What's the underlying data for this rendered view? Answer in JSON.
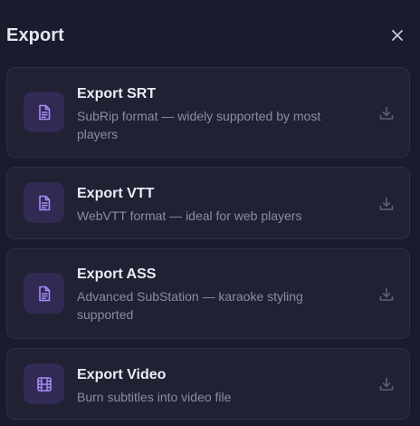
{
  "dialog": {
    "title": "Export",
    "close_icon": "close-icon"
  },
  "options": [
    {
      "title": "Export SRT",
      "description": "SubRip format — widely supported by most players",
      "icon": "document-icon",
      "action_icon": "download-icon"
    },
    {
      "title": "Export VTT",
      "description": "WebVTT format — ideal for web players",
      "icon": "document-icon",
      "action_icon": "download-icon"
    },
    {
      "title": "Export ASS",
      "description": "Advanced SubStation — karaoke styling supported",
      "icon": "document-icon",
      "action_icon": "download-icon"
    },
    {
      "title": "Export Video",
      "description": "Burn subtitles into video file",
      "icon": "film-icon",
      "action_icon": "download-icon"
    }
  ],
  "colors": {
    "background": "#1a1b2c",
    "card": "#202133",
    "card_border": "#2e3045",
    "icon_tile": "#312a52",
    "accent": "#a78bfa",
    "title_text": "#ececf5",
    "description_text": "#8b8ca3",
    "muted_icon": "#5f6078"
  }
}
